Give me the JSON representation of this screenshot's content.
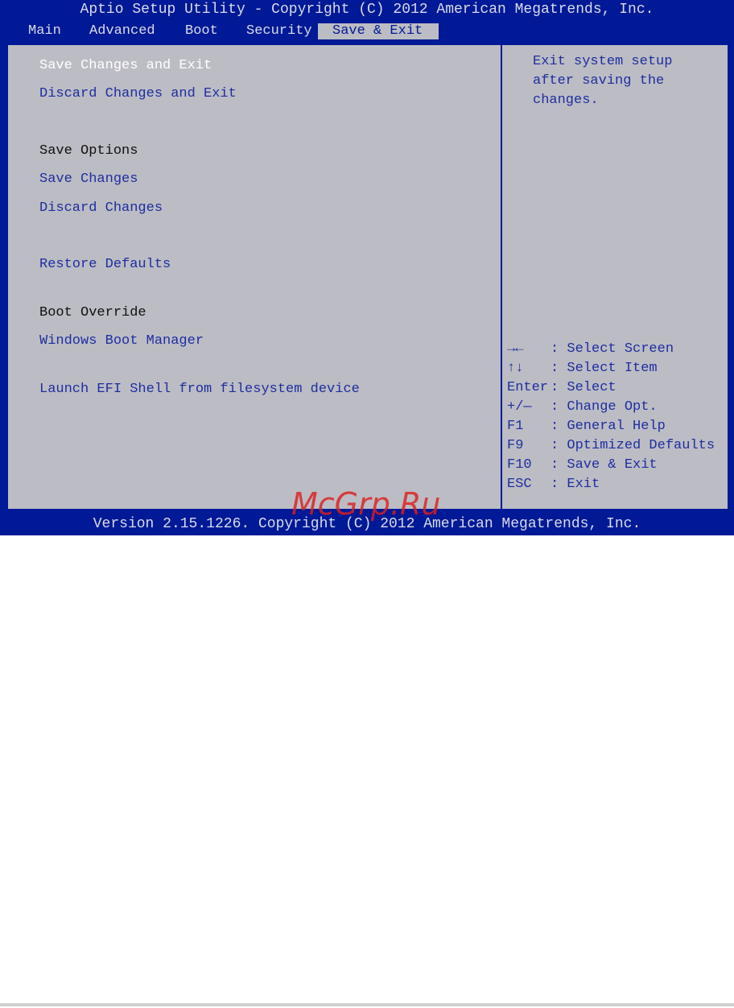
{
  "header": {
    "title": "Aptio Setup Utility - Copyright (C) 2012 American Megatrends, Inc."
  },
  "tabs": [
    {
      "label": "Main"
    },
    {
      "label": "Advanced"
    },
    {
      "label": "Boot"
    },
    {
      "label": "Security"
    },
    {
      "label": "Save & Exit",
      "active": true
    }
  ],
  "menu": {
    "save_changes_and_exit": "Save Changes and Exit",
    "discard_changes_and_exit": "Discard Changes and Exit",
    "save_options_heading": "Save Options",
    "save_changes": "Save Changes",
    "discard_changes": "Discard Changes",
    "restore_defaults": "Restore Defaults",
    "boot_override_heading": "Boot Override",
    "windows_boot_manager": "Windows Boot Manager",
    "launch_efi_shell": "Launch EFI Shell from filesystem device"
  },
  "help": {
    "line1": "Exit system setup",
    "line2": "after saving the",
    "line3": "changes."
  },
  "keys": [
    {
      "key": "→←",
      "desc": ": Select Screen"
    },
    {
      "key": "↑↓",
      "desc": ": Select Item"
    },
    {
      "key": "Enter",
      "desc": ": Select"
    },
    {
      "key": "+/—",
      "desc": ": Change Opt."
    },
    {
      "key": "F1",
      "desc": ": General Help"
    },
    {
      "key": "F9",
      "desc": ": Optimized Defaults"
    },
    {
      "key": "F10",
      "desc": ": Save & Exit"
    },
    {
      "key": "ESC",
      "desc": ": Exit"
    }
  ],
  "footer": {
    "version": "Version 2.15.1226. Copyright (C) 2012 American Megatrends, Inc."
  },
  "watermark": "McGrp.Ru",
  "colors": {
    "bios_blue": "#001996",
    "panel_gray": "#bcbcc4",
    "item_blue": "#1e2ea0",
    "selected_white": "#ffffff",
    "watermark_red": "#dc1e1e"
  }
}
